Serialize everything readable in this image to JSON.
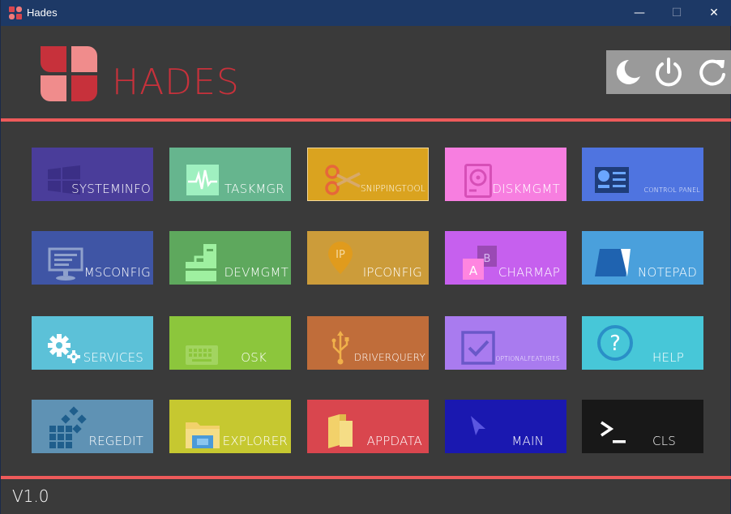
{
  "window": {
    "title": "Hades",
    "controls": {
      "minimize": "—",
      "maximize": "☐",
      "close": "✕"
    }
  },
  "header": {
    "brand": "HADES",
    "brand_color": "#c7313b",
    "accent_rule_color": "#ee5a5a",
    "power_buttons": [
      {
        "name": "sleep-icon"
      },
      {
        "name": "power-icon"
      },
      {
        "name": "restart-icon"
      }
    ]
  },
  "tiles": [
    {
      "label": "SYSTEMINFO",
      "color": "#4a3d9a",
      "icon": "windows-logo-icon"
    },
    {
      "label": "TASKMGR",
      "color": "#66b58e",
      "icon": "heartbeat-monitor-icon"
    },
    {
      "label": "SNIPPINGTOOL",
      "color": "#daa31f",
      "icon": "scissors-icon"
    },
    {
      "label": "DISKMGMT",
      "color": "#f77ee0",
      "icon": "hard-disk-icon"
    },
    {
      "label": "CONTROL PANEL",
      "color": "#4f74e0",
      "icon": "control-panel-icon"
    },
    {
      "label": "MSCONFIG",
      "color": "#3f55a5",
      "icon": "monitor-config-icon"
    },
    {
      "label": "DEVMGMT",
      "color": "#5ea85d",
      "icon": "device-tree-icon"
    },
    {
      "label": "IPCONFIG",
      "color": "#cc9c3a",
      "icon": "ip-pin-icon",
      "icon_text": "IP"
    },
    {
      "label": "CHARMAP",
      "color": "#c660ee",
      "icon": "character-map-icon",
      "icon_text_a": "A",
      "icon_text_b": "B"
    },
    {
      "label": "NOTEPAD",
      "color": "#4aa0dc",
      "icon": "notepad-icon"
    },
    {
      "label": "SERVICES",
      "color": "#5cc1d8",
      "icon": "gears-icon"
    },
    {
      "label": "OSK",
      "color": "#8cc63c",
      "icon": "keyboard-icon"
    },
    {
      "label": "DRIVERQUERY",
      "color": "#c06d3a",
      "icon": "usb-icon"
    },
    {
      "label": "OPTIONALFEATURES",
      "color": "#a97bef",
      "icon": "checkbox-icon"
    },
    {
      "label": "HELP",
      "color": "#47c7d8",
      "icon": "help-icon",
      "icon_text": "?"
    },
    {
      "label": "REGEDIT",
      "color": "#5f92b4",
      "icon": "registry-cubes-icon"
    },
    {
      "label": "EXPLORER",
      "color": "#c6c830",
      "icon": "folder-icon"
    },
    {
      "label": "APPDATA",
      "color": "#d9464e",
      "icon": "appdata-folder-icon"
    },
    {
      "label": "MAIN",
      "color": "#1a18b0",
      "icon": "cursor-arrow-icon"
    },
    {
      "label": "CLS",
      "color": "#181818",
      "icon": "terminal-prompt-icon",
      "icon_text": ">_"
    }
  ],
  "footer": {
    "version": "V1.0"
  }
}
